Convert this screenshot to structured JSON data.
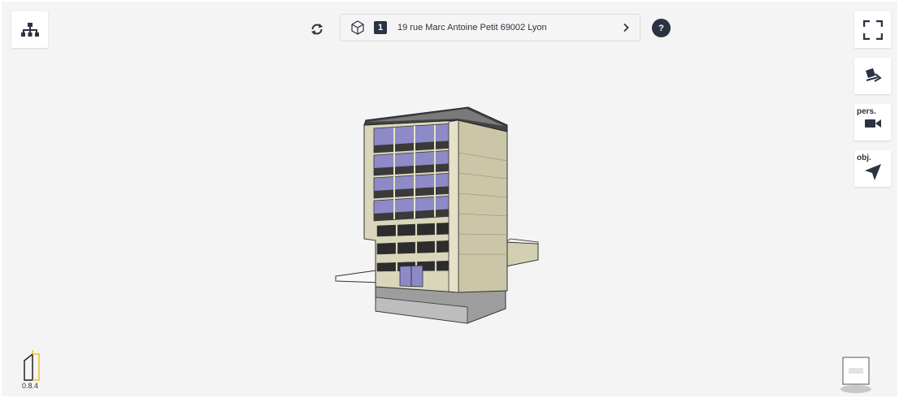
{
  "header": {
    "floor_badge": "1",
    "address": "19 rue Marc Antoine Petit 69002 Lyon",
    "help_label": "?"
  },
  "toolbar": {
    "perspective_label": "pers.",
    "object_label": "obj."
  },
  "app": {
    "version": "0.8.4"
  },
  "colors": {
    "accent_dark": "#2b3342",
    "logo_yellow": "#f2c12e",
    "facade": "#d9d6bb",
    "window_blue": "#8d8ac7"
  }
}
